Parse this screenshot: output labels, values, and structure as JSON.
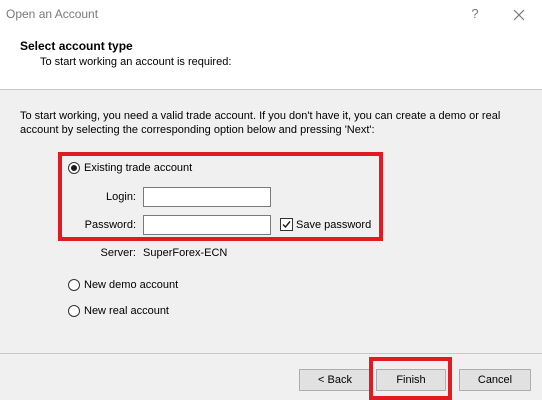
{
  "window": {
    "title": "Open an Account",
    "help_label": "?"
  },
  "header": {
    "title": "Select account type",
    "subtitle": "To start working an account is required:"
  },
  "body": {
    "description": "To start working, you need a valid trade account. If you don't have it, you can create a demo or real account by selecting the corresponding option below and pressing 'Next':",
    "options": {
      "existing": {
        "label": "Existing trade account",
        "checked": true
      },
      "demo": {
        "label": "New demo account",
        "checked": false
      },
      "real": {
        "label": "New real account",
        "checked": false
      }
    },
    "login": {
      "label": "Login:",
      "value": ""
    },
    "password": {
      "label": "Password:",
      "value": ""
    },
    "save_password": {
      "label": "Save password",
      "checked": true
    },
    "server": {
      "label": "Server:",
      "value": "SuperForex-ECN"
    }
  },
  "footer": {
    "back_label": "< Back",
    "finish_label": "Finish",
    "cancel_label": "Cancel"
  },
  "colors": {
    "highlight": "#e01b24",
    "panel_background": "#f0f0f0",
    "button_background": "#e1e1e1"
  }
}
